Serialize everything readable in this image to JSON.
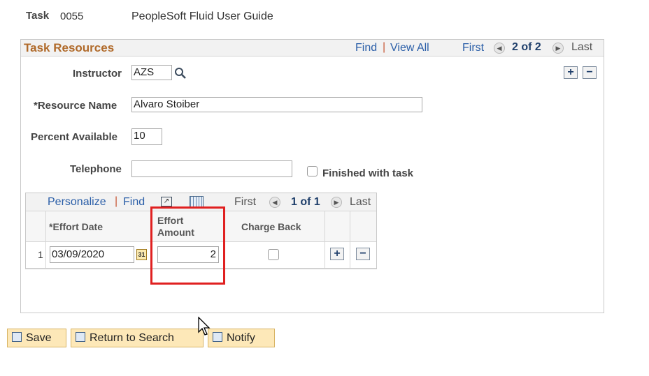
{
  "header": {
    "task_label": "Task",
    "task_value": "0055",
    "task_description": "PeopleSoft Fluid User Guide"
  },
  "resources": {
    "title": "Task Resources",
    "find": "Find",
    "view_all": "View All",
    "first": "First",
    "position": "2 of 2",
    "last": "Last",
    "instructor_label": "Instructor",
    "instructor_value": "AZS",
    "resource_name_label": "*Resource Name",
    "resource_name_value": "Alvaro Stoiber",
    "percent_label": "Percent Available",
    "percent_value": "10",
    "telephone_label": "Telephone",
    "telephone_value": "",
    "finished_label": "Finished with task"
  },
  "grid": {
    "personalize": "Personalize",
    "find": "Find",
    "first": "First",
    "position": "1 of 1",
    "last": "Last",
    "col_effort_date": "*Effort Date",
    "col_effort_amount_1": "Effort",
    "col_effort_amount_2": "Amount",
    "col_charge_back": "Charge Back",
    "rows": [
      {
        "num": "1",
        "effort_date": "03/09/2020",
        "effort_amount": "2"
      }
    ]
  },
  "buttons": {
    "save": "Save",
    "return_to_search": "Return to Search",
    "notify": "Notify"
  },
  "colors": {
    "highlight_box": "#e02020",
    "section_title": "#b06a2a",
    "link": "#2a5ea8",
    "button_fill": "#fde8b8"
  }
}
